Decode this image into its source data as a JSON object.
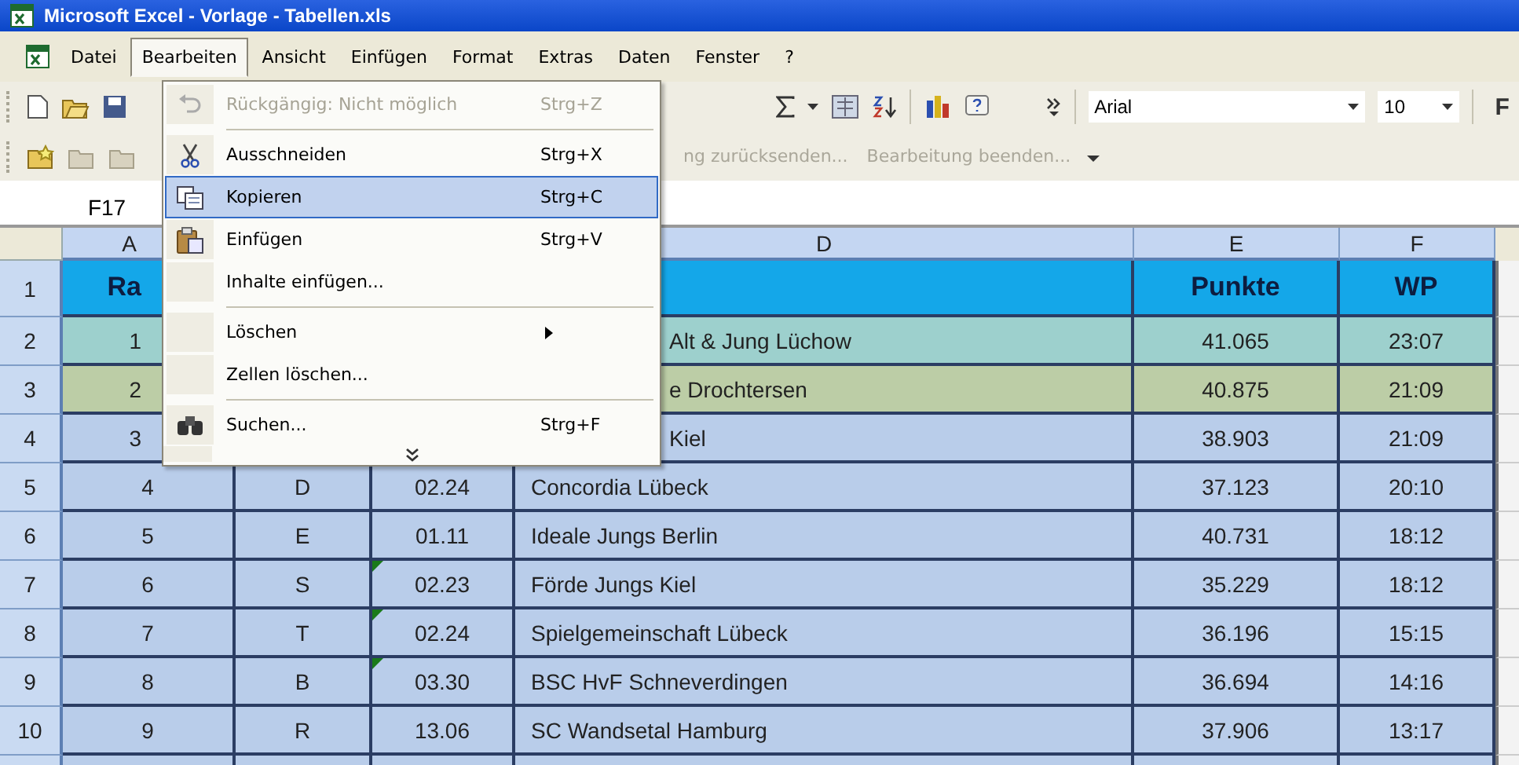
{
  "window": {
    "title": "Microsoft Excel - Vorlage - Tabellen.xls"
  },
  "menu_bar": [
    {
      "label": "Datei",
      "selected": false
    },
    {
      "label": "Bearbeiten",
      "selected": true
    },
    {
      "label": "Ansicht",
      "selected": false
    },
    {
      "label": "Einfügen",
      "selected": false
    },
    {
      "label": "Format",
      "selected": false
    },
    {
      "label": "Extras",
      "selected": false
    },
    {
      "label": "Daten",
      "selected": false
    },
    {
      "label": "Fenster",
      "selected": false
    },
    {
      "label": "?",
      "selected": false
    }
  ],
  "toolbar": {
    "font": "Arial",
    "size": "10",
    "bold": "F"
  },
  "review_toolbar": {
    "buttons": [
      {
        "label": "ng zurücksenden...",
        "disabled": true
      },
      {
        "label": "Bearbeitung beenden...",
        "disabled": true
      }
    ]
  },
  "name_box": "F17",
  "edit_menu": {
    "items": [
      {
        "kind": "item",
        "label": "Rückgängig: Nicht möglich",
        "shortcut": "Strg+Z",
        "disabled": true,
        "selected": false
      },
      {
        "kind": "separator"
      },
      {
        "kind": "item",
        "label": "Ausschneiden",
        "shortcut": "Strg+X",
        "disabled": false,
        "selected": false
      },
      {
        "kind": "item",
        "label": "Kopieren",
        "shortcut": "Strg+C",
        "disabled": false,
        "selected": true
      },
      {
        "kind": "item",
        "label": "Einfügen",
        "shortcut": "Strg+V",
        "disabled": false,
        "selected": false
      },
      {
        "kind": "item",
        "label": "Inhalte einfügen...",
        "disabled": false,
        "selected": false
      },
      {
        "kind": "separator"
      },
      {
        "kind": "submenu",
        "label": "Löschen",
        "disabled": false,
        "selected": false
      },
      {
        "kind": "item",
        "label": "Zellen löschen...",
        "disabled": false,
        "selected": false
      },
      {
        "kind": "separator"
      },
      {
        "kind": "item",
        "label": "Suchen...",
        "shortcut": "Strg+F",
        "disabled": false,
        "selected": false
      },
      {
        "kind": "more"
      }
    ]
  },
  "sheet": {
    "column_headers": {
      "A": "A",
      "D": "D",
      "E": "E",
      "F": "F"
    },
    "rows": [
      {
        "number": "1",
        "kind": "heading",
        "color": "#14a7e9",
        "marker": false,
        "cells": {
          "A": "Ra",
          "E": "Punkte",
          "F": "WP"
        }
      },
      {
        "number": "2",
        "kind": "data",
        "color": "#9dd0cd",
        "marker": false,
        "cells": {
          "A": "1",
          "D": "Alt & Jung Lüchow",
          "E": "41.065",
          "F": "23:07"
        }
      },
      {
        "number": "3",
        "kind": "data",
        "color": "#bccda6",
        "marker": false,
        "cells": {
          "A": "2",
          "D": "e Drochtersen",
          "E": "40.875",
          "F": "21:09"
        }
      },
      {
        "number": "4",
        "kind": "data",
        "color": "#b9cdea",
        "marker": false,
        "cells": {
          "A": "3",
          "D": "Kiel",
          "E": "38.903",
          "F": "21:09"
        }
      },
      {
        "number": "5",
        "kind": "data",
        "color": "#b9cdea",
        "marker": false,
        "cells": {
          "A": "4",
          "B": "D",
          "C": "02.24",
          "D": "Concordia Lübeck",
          "E": "37.123",
          "F": "20:10"
        }
      },
      {
        "number": "6",
        "kind": "data",
        "color": "#b9cdea",
        "marker": false,
        "cells": {
          "A": "5",
          "B": "E",
          "C": "01.11",
          "D": "Ideale Jungs Berlin",
          "E": "40.731",
          "F": "18:12"
        }
      },
      {
        "number": "7",
        "kind": "data",
        "color": "#b9cdea",
        "marker": true,
        "cells": {
          "A": "6",
          "B": "S",
          "C": "02.23",
          "D": "Förde Jungs Kiel",
          "E": "35.229",
          "F": "18:12"
        }
      },
      {
        "number": "8",
        "kind": "data",
        "color": "#b9cdea",
        "marker": true,
        "cells": {
          "A": "7",
          "B": "T",
          "C": "02.24",
          "D": "Spielgemeinschaft Lübeck",
          "E": "36.196",
          "F": "15:15"
        }
      },
      {
        "number": "9",
        "kind": "data",
        "color": "#b9cdea",
        "marker": true,
        "cells": {
          "A": "8",
          "B": "B",
          "C": "03.30",
          "D": "BSC HvF Schneverdingen",
          "E": "36.694",
          "F": "14:16"
        }
      },
      {
        "number": "10",
        "kind": "data",
        "color": "#b9cdea",
        "marker": false,
        "cells": {
          "A": "9",
          "B": "R",
          "C": "13.06",
          "D": "SC Wandsetal Hamburg",
          "E": "37.906",
          "F": "13:17"
        }
      }
    ]
  }
}
